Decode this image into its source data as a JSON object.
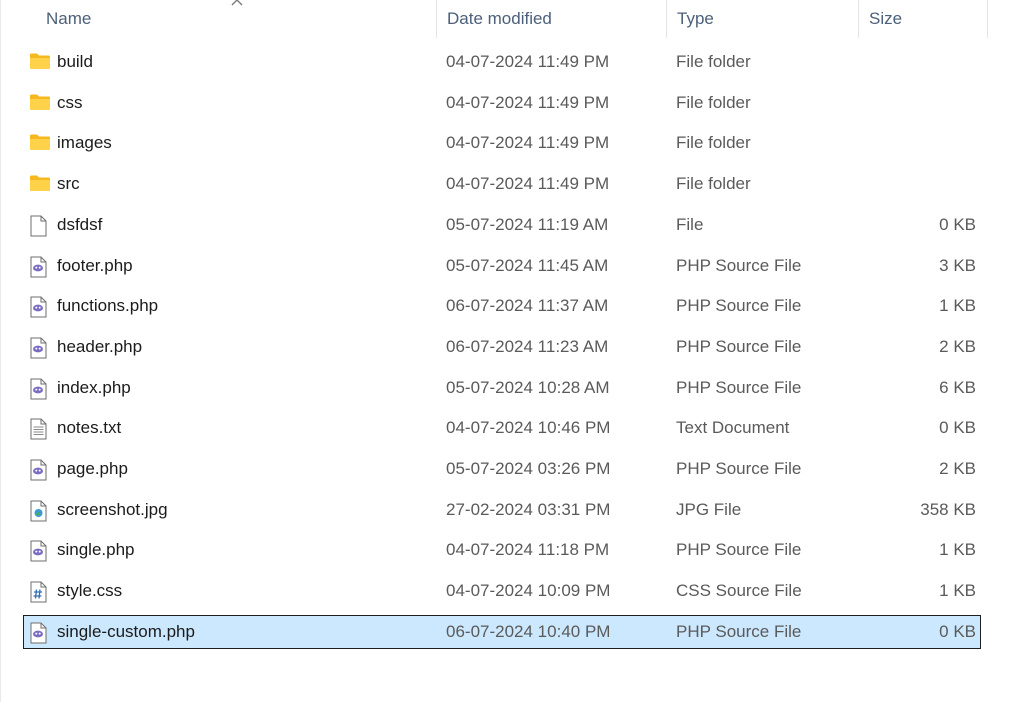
{
  "columns": {
    "name": "Name",
    "date_modified": "Date modified",
    "type": "Type",
    "size": "Size"
  },
  "sort": {
    "column": "name",
    "direction": "ascending",
    "icon": "chevron-up-icon"
  },
  "files": [
    {
      "name": "build",
      "date": "04-07-2024 11:49 PM",
      "type": "File folder",
      "size": "",
      "icon": "folder-icon",
      "selected": false
    },
    {
      "name": "css",
      "date": "04-07-2024 11:49 PM",
      "type": "File folder",
      "size": "",
      "icon": "folder-icon",
      "selected": false
    },
    {
      "name": "images",
      "date": "04-07-2024 11:49 PM",
      "type": "File folder",
      "size": "",
      "icon": "folder-icon",
      "selected": false
    },
    {
      "name": "src",
      "date": "04-07-2024 11:49 PM",
      "type": "File folder",
      "size": "",
      "icon": "folder-icon",
      "selected": false
    },
    {
      "name": "dsfdsf",
      "date": "05-07-2024 11:19 AM",
      "type": "File",
      "size": "0 KB",
      "icon": "blank-file-icon",
      "selected": false
    },
    {
      "name": "footer.php",
      "date": "05-07-2024 11:45 AM",
      "type": "PHP Source File",
      "size": "3 KB",
      "icon": "php-file-icon",
      "selected": false
    },
    {
      "name": "functions.php",
      "date": "06-07-2024 11:37 AM",
      "type": "PHP Source File",
      "size": "1 KB",
      "icon": "php-file-icon",
      "selected": false
    },
    {
      "name": "header.php",
      "date": "06-07-2024 11:23 AM",
      "type": "PHP Source File",
      "size": "2 KB",
      "icon": "php-file-icon",
      "selected": false
    },
    {
      "name": "index.php",
      "date": "05-07-2024 10:28 AM",
      "type": "PHP Source File",
      "size": "6 KB",
      "icon": "php-file-icon",
      "selected": false
    },
    {
      "name": "notes.txt",
      "date": "04-07-2024 10:46 PM",
      "type": "Text Document",
      "size": "0 KB",
      "icon": "text-file-icon",
      "selected": false
    },
    {
      "name": "page.php",
      "date": "05-07-2024 03:26 PM",
      "type": "PHP Source File",
      "size": "2 KB",
      "icon": "php-file-icon",
      "selected": false
    },
    {
      "name": "screenshot.jpg",
      "date": "27-02-2024 03:31 PM",
      "type": "JPG File",
      "size": "358 KB",
      "icon": "image-file-icon",
      "selected": false
    },
    {
      "name": "single.php",
      "date": "04-07-2024 11:18 PM",
      "type": "PHP Source File",
      "size": "1 KB",
      "icon": "php-file-icon",
      "selected": false
    },
    {
      "name": "style.css",
      "date": "04-07-2024 10:09 PM",
      "type": "CSS Source File",
      "size": "1 KB",
      "icon": "css-file-icon",
      "selected": false
    },
    {
      "name": "single-custom.php",
      "date": "06-07-2024 10:40 PM",
      "type": "PHP Source File",
      "size": "0 KB",
      "icon": "php-file-icon",
      "selected": true
    }
  ],
  "colors": {
    "header_text": "#4c607a",
    "selection_bg": "#cce8ff",
    "folder": "#f8c93b",
    "php_accent": "#7a6cc2"
  }
}
